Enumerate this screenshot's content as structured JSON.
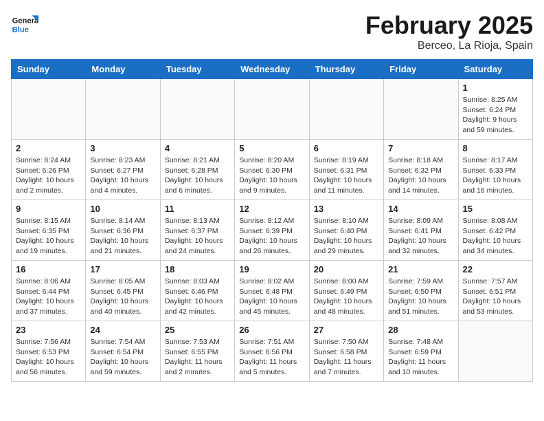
{
  "header": {
    "logo_general": "General",
    "logo_blue": "Blue",
    "month_title": "February 2025",
    "location": "Berceo, La Rioja, Spain"
  },
  "weekdays": [
    "Sunday",
    "Monday",
    "Tuesday",
    "Wednesday",
    "Thursday",
    "Friday",
    "Saturday"
  ],
  "weeks": [
    [
      {
        "day": "",
        "info": ""
      },
      {
        "day": "",
        "info": ""
      },
      {
        "day": "",
        "info": ""
      },
      {
        "day": "",
        "info": ""
      },
      {
        "day": "",
        "info": ""
      },
      {
        "day": "",
        "info": ""
      },
      {
        "day": "1",
        "info": "Sunrise: 8:25 AM\nSunset: 6:24 PM\nDaylight: 9 hours and 59 minutes."
      }
    ],
    [
      {
        "day": "2",
        "info": "Sunrise: 8:24 AM\nSunset: 6:26 PM\nDaylight: 10 hours and 2 minutes."
      },
      {
        "day": "3",
        "info": "Sunrise: 8:23 AM\nSunset: 6:27 PM\nDaylight: 10 hours and 4 minutes."
      },
      {
        "day": "4",
        "info": "Sunrise: 8:21 AM\nSunset: 6:28 PM\nDaylight: 10 hours and 6 minutes."
      },
      {
        "day": "5",
        "info": "Sunrise: 8:20 AM\nSunset: 6:30 PM\nDaylight: 10 hours and 9 minutes."
      },
      {
        "day": "6",
        "info": "Sunrise: 8:19 AM\nSunset: 6:31 PM\nDaylight: 10 hours and 11 minutes."
      },
      {
        "day": "7",
        "info": "Sunrise: 8:18 AM\nSunset: 6:32 PM\nDaylight: 10 hours and 14 minutes."
      },
      {
        "day": "8",
        "info": "Sunrise: 8:17 AM\nSunset: 6:33 PM\nDaylight: 10 hours and 16 minutes."
      }
    ],
    [
      {
        "day": "9",
        "info": "Sunrise: 8:15 AM\nSunset: 6:35 PM\nDaylight: 10 hours and 19 minutes."
      },
      {
        "day": "10",
        "info": "Sunrise: 8:14 AM\nSunset: 6:36 PM\nDaylight: 10 hours and 21 minutes."
      },
      {
        "day": "11",
        "info": "Sunrise: 8:13 AM\nSunset: 6:37 PM\nDaylight: 10 hours and 24 minutes."
      },
      {
        "day": "12",
        "info": "Sunrise: 8:12 AM\nSunset: 6:39 PM\nDaylight: 10 hours and 26 minutes."
      },
      {
        "day": "13",
        "info": "Sunrise: 8:10 AM\nSunset: 6:40 PM\nDaylight: 10 hours and 29 minutes."
      },
      {
        "day": "14",
        "info": "Sunrise: 8:09 AM\nSunset: 6:41 PM\nDaylight: 10 hours and 32 minutes."
      },
      {
        "day": "15",
        "info": "Sunrise: 8:08 AM\nSunset: 6:42 PM\nDaylight: 10 hours and 34 minutes."
      }
    ],
    [
      {
        "day": "16",
        "info": "Sunrise: 8:06 AM\nSunset: 6:44 PM\nDaylight: 10 hours and 37 minutes."
      },
      {
        "day": "17",
        "info": "Sunrise: 8:05 AM\nSunset: 6:45 PM\nDaylight: 10 hours and 40 minutes."
      },
      {
        "day": "18",
        "info": "Sunrise: 8:03 AM\nSunset: 6:46 PM\nDaylight: 10 hours and 42 minutes."
      },
      {
        "day": "19",
        "info": "Sunrise: 8:02 AM\nSunset: 6:48 PM\nDaylight: 10 hours and 45 minutes."
      },
      {
        "day": "20",
        "info": "Sunrise: 8:00 AM\nSunset: 6:49 PM\nDaylight: 10 hours and 48 minutes."
      },
      {
        "day": "21",
        "info": "Sunrise: 7:59 AM\nSunset: 6:50 PM\nDaylight: 10 hours and 51 minutes."
      },
      {
        "day": "22",
        "info": "Sunrise: 7:57 AM\nSunset: 6:51 PM\nDaylight: 10 hours and 53 minutes."
      }
    ],
    [
      {
        "day": "23",
        "info": "Sunrise: 7:56 AM\nSunset: 6:53 PM\nDaylight: 10 hours and 56 minutes."
      },
      {
        "day": "24",
        "info": "Sunrise: 7:54 AM\nSunset: 6:54 PM\nDaylight: 10 hours and 59 minutes."
      },
      {
        "day": "25",
        "info": "Sunrise: 7:53 AM\nSunset: 6:55 PM\nDaylight: 11 hours and 2 minutes."
      },
      {
        "day": "26",
        "info": "Sunrise: 7:51 AM\nSunset: 6:56 PM\nDaylight: 11 hours and 5 minutes."
      },
      {
        "day": "27",
        "info": "Sunrise: 7:50 AM\nSunset: 6:58 PM\nDaylight: 11 hours and 7 minutes."
      },
      {
        "day": "28",
        "info": "Sunrise: 7:48 AM\nSunset: 6:59 PM\nDaylight: 11 hours and 10 minutes."
      },
      {
        "day": "",
        "info": ""
      }
    ]
  ]
}
